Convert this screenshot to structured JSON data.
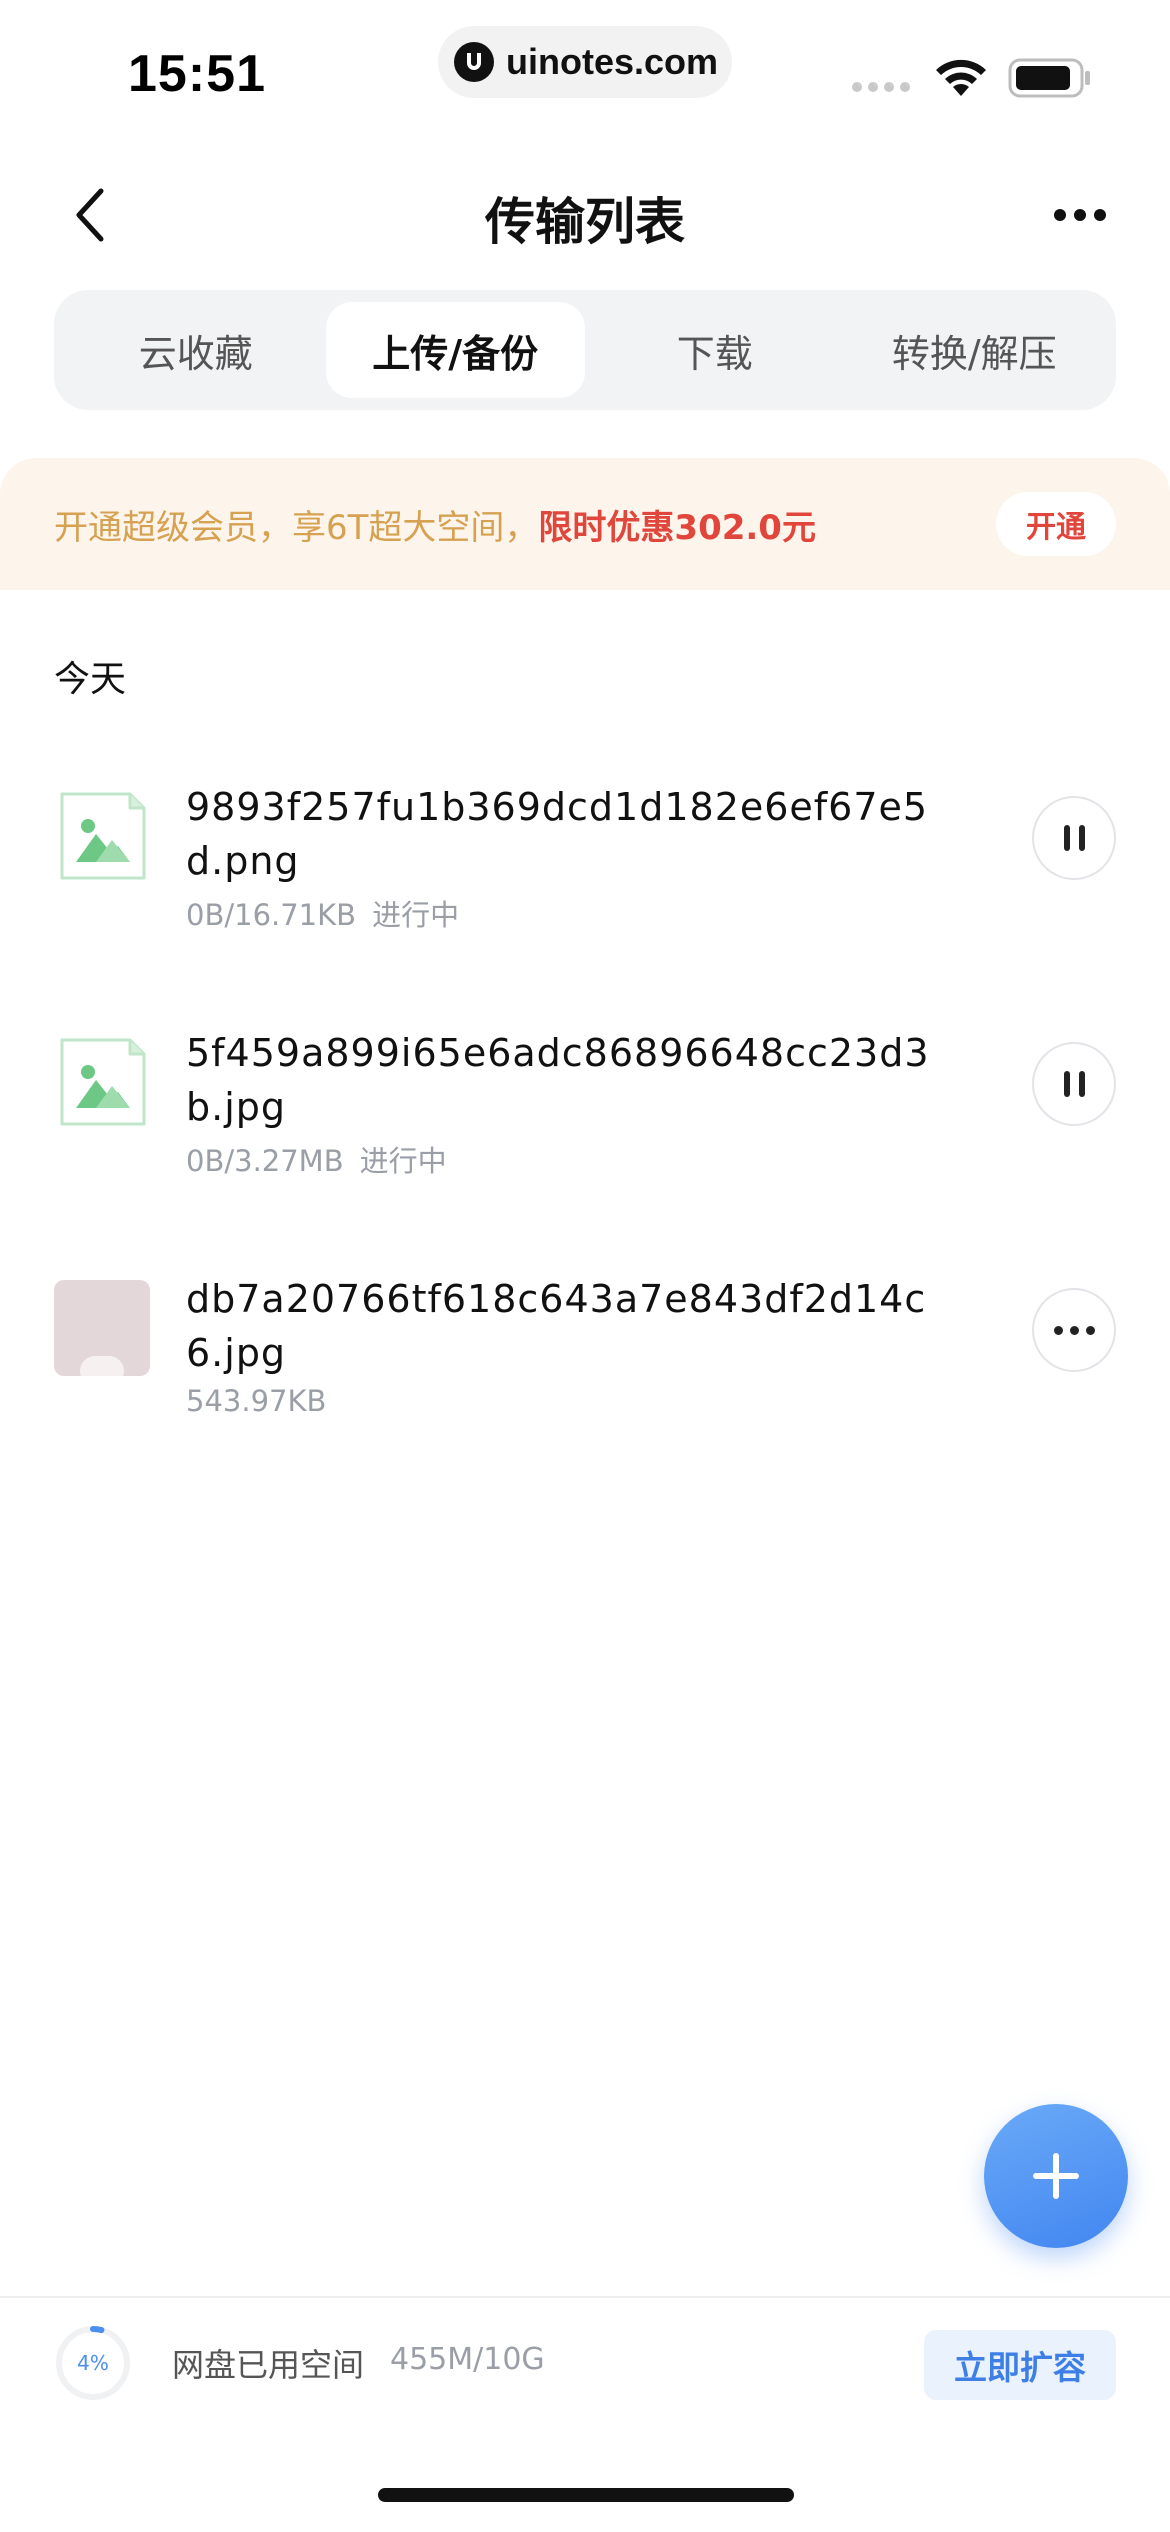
{
  "status_bar": {
    "time": "15:51",
    "url": "uinotes.com",
    "icons": [
      "signal-icon",
      "wifi-icon",
      "battery-icon"
    ]
  },
  "nav": {
    "title": "传输列表",
    "back_icon": "chevron-left-icon",
    "more_icon": "more-icon"
  },
  "tabs": [
    {
      "label": "云收藏",
      "active": false
    },
    {
      "label": "上传/备份",
      "active": true
    },
    {
      "label": "下载",
      "active": false
    },
    {
      "label": "转换/解压",
      "active": false
    }
  ],
  "promo": {
    "text": "开通超级会员，享6T超大空间，",
    "highlight": "限时优惠302.0元",
    "button": "开通",
    "colors": {
      "text": "#d6a150",
      "highlight": "#e0463b",
      "background": "#fdf5ec"
    }
  },
  "section_label": "今天",
  "files": [
    {
      "name": "9893f257fu1b369dcd1d182e6ef67e5d.png",
      "size": "0B/16.71KB",
      "status": "进行中",
      "action": "pause-icon",
      "icon": "image-file-icon"
    },
    {
      "name": "5f459a899i65e6adc86896648cc23d3b.jpg",
      "size": "0B/3.27MB",
      "status": "进行中",
      "action": "pause-icon",
      "icon": "image-file-icon"
    },
    {
      "name": "db7a20766tf618c643a7e843df2d14c6.jpg",
      "size": "543.97KB",
      "status": "",
      "action": "more-icon",
      "icon": "image-thumbnail"
    }
  ],
  "fab": {
    "icon": "plus-icon",
    "color": "#4a8ef0"
  },
  "storage": {
    "percent": "4%",
    "used_fraction": 0.04,
    "label": "网盘已用空间",
    "value": "455M/10G",
    "button": "立即扩容",
    "accent": "#3d7fe6"
  }
}
